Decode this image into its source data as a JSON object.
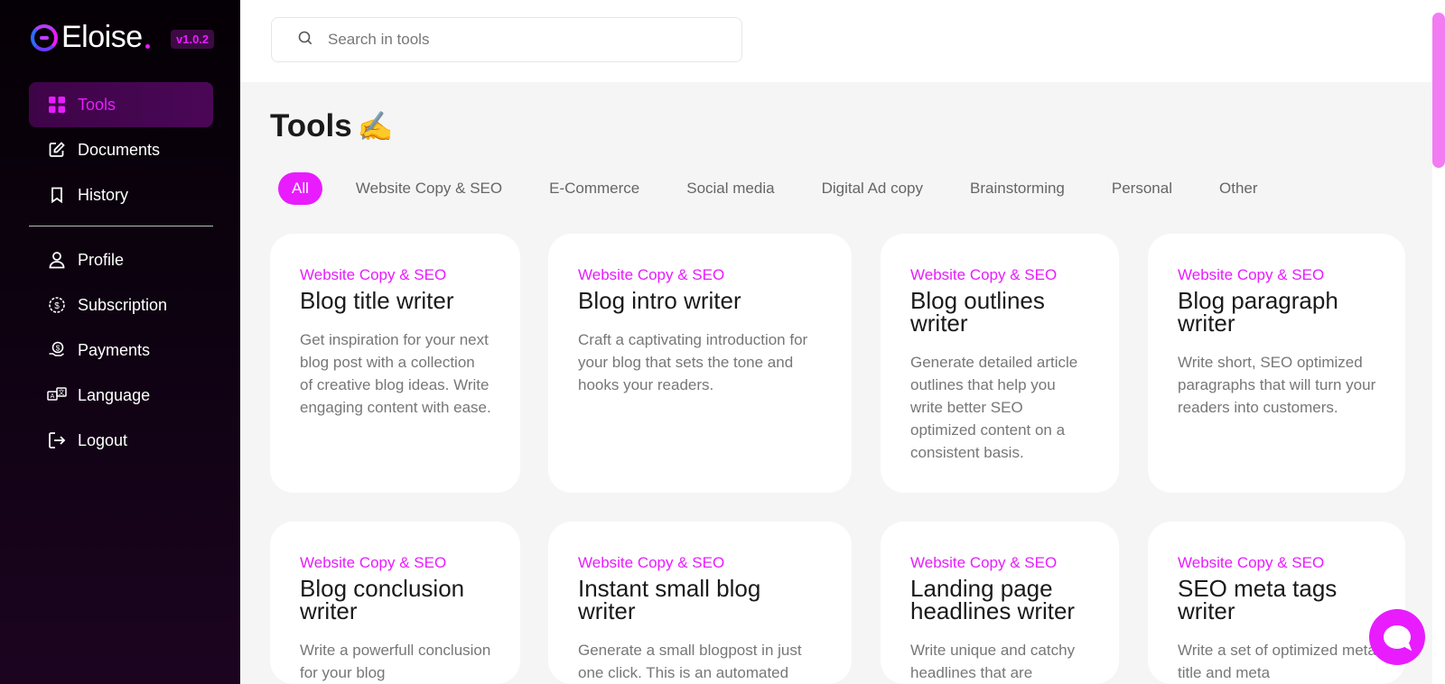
{
  "brand": {
    "name": "Eloise",
    "version": "v1.0.2"
  },
  "sidebar": {
    "items": [
      {
        "label": "Tools",
        "icon": "grid-icon"
      },
      {
        "label": "Documents",
        "icon": "edit-document-icon"
      },
      {
        "label": "History",
        "icon": "bookmark-icon"
      }
    ],
    "account_items": [
      {
        "label": "Profile",
        "icon": "user-icon"
      },
      {
        "label": "Subscription",
        "icon": "dollar-badge-icon"
      },
      {
        "label": "Payments",
        "icon": "payment-hand-icon"
      },
      {
        "label": "Language",
        "icon": "language-icon"
      },
      {
        "label": "Logout",
        "icon": "logout-icon"
      }
    ]
  },
  "search": {
    "placeholder": "Search in tools"
  },
  "main": {
    "title": "Tools",
    "title_emoji": "✍️",
    "filters": [
      "All",
      "Website Copy & SEO",
      "E-Commerce",
      "Social media",
      "Digital Ad copy",
      "Brainstorming",
      "Personal",
      "Other"
    ],
    "cards": [
      {
        "category": "Website Copy & SEO",
        "title": "Blog title writer",
        "desc": "Get inspiration for your next blog post with a collection of creative blog ideas. Write engaging content with ease."
      },
      {
        "category": "Website Copy & SEO",
        "title": "Blog intro writer",
        "desc": "Craft a captivating introduction for your blog that sets the tone and hooks your readers."
      },
      {
        "category": "Website Copy & SEO",
        "title": "Blog outlines writer",
        "desc": "Generate detailed article outlines that help you write better SEO optimized content on a consistent basis."
      },
      {
        "category": "Website Copy & SEO",
        "title": "Blog paragraph writer",
        "desc": "Write short, SEO optimized paragraphs that will turn your readers into customers."
      },
      {
        "category": "Website Copy & SEO",
        "title": "Blog conclusion writer",
        "desc": "Write a powerfull conclusion for your blog"
      },
      {
        "category": "Website Copy & SEO",
        "title": "Instant small blog writer",
        "desc": "Generate a small blogpost in just one click. This is an automated"
      },
      {
        "category": "Website Copy & SEO",
        "title": "Landing page headlines writer",
        "desc": "Write unique and catchy headlines that are"
      },
      {
        "category": "Website Copy & SEO",
        "title": "SEO meta tags writer",
        "desc": "Write a set of optimized meta title and meta"
      }
    ]
  },
  "colors": {
    "accent": "#e81cff",
    "sidebar_bg": "#0d0210",
    "page_bg": "#f5f5f5"
  }
}
